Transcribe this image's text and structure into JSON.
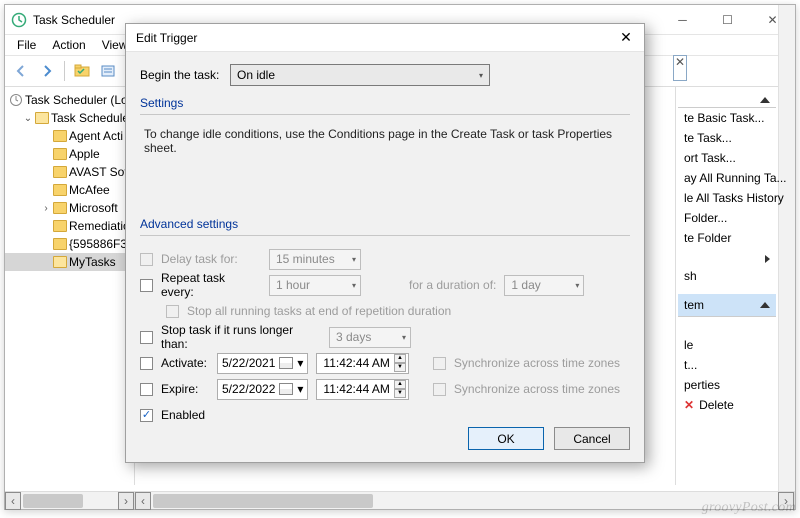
{
  "window": {
    "title": "Task Scheduler",
    "menus": [
      "File",
      "Action",
      "View"
    ]
  },
  "tree": {
    "root": "Task Scheduler (Lo",
    "lib": "Task Scheduler",
    "items": [
      "Agent Acti",
      "Apple",
      "AVAST Soft",
      "McAfee",
      "Microsoft",
      "Remediatio",
      "{595886F3-",
      "MyTasks"
    ]
  },
  "actions": {
    "items": [
      "te Basic Task...",
      "te Task...",
      "ort Task...",
      "ay All Running Ta...",
      "le All Tasks History",
      "Folder...",
      "te Folder",
      "sh"
    ],
    "section_label": "tem",
    "sub_items": [
      "le",
      "t...",
      "perties",
      "Delete"
    ]
  },
  "dialog": {
    "title": "Edit Trigger",
    "begin_label": "Begin the task:",
    "begin_value": "On idle",
    "settings_label": "Settings",
    "help_text": "To change idle conditions, use the Conditions page in the Create Task or task Properties sheet.",
    "adv_label": "Advanced settings",
    "delay_label": "Delay task for:",
    "delay_value": "15 minutes",
    "repeat_label": "Repeat task every:",
    "repeat_value": "1 hour",
    "duration_label": "for a duration of:",
    "duration_value": "1 day",
    "stop_repeat_label": "Stop all running tasks at end of repetition duration",
    "stop_if_label": "Stop task if it runs longer than:",
    "stop_if_value": "3 days",
    "activate_label": "Activate:",
    "activate_date": "5/22/2021",
    "activate_time": "11:42:44 AM",
    "expire_label": "Expire:",
    "expire_date": "5/22/2022",
    "expire_time": "11:42:44 AM",
    "sync_label": "Synchronize across time zones",
    "enabled_label": "Enabled",
    "ok": "OK",
    "cancel": "Cancel"
  },
  "watermark": "groovyPost.com"
}
